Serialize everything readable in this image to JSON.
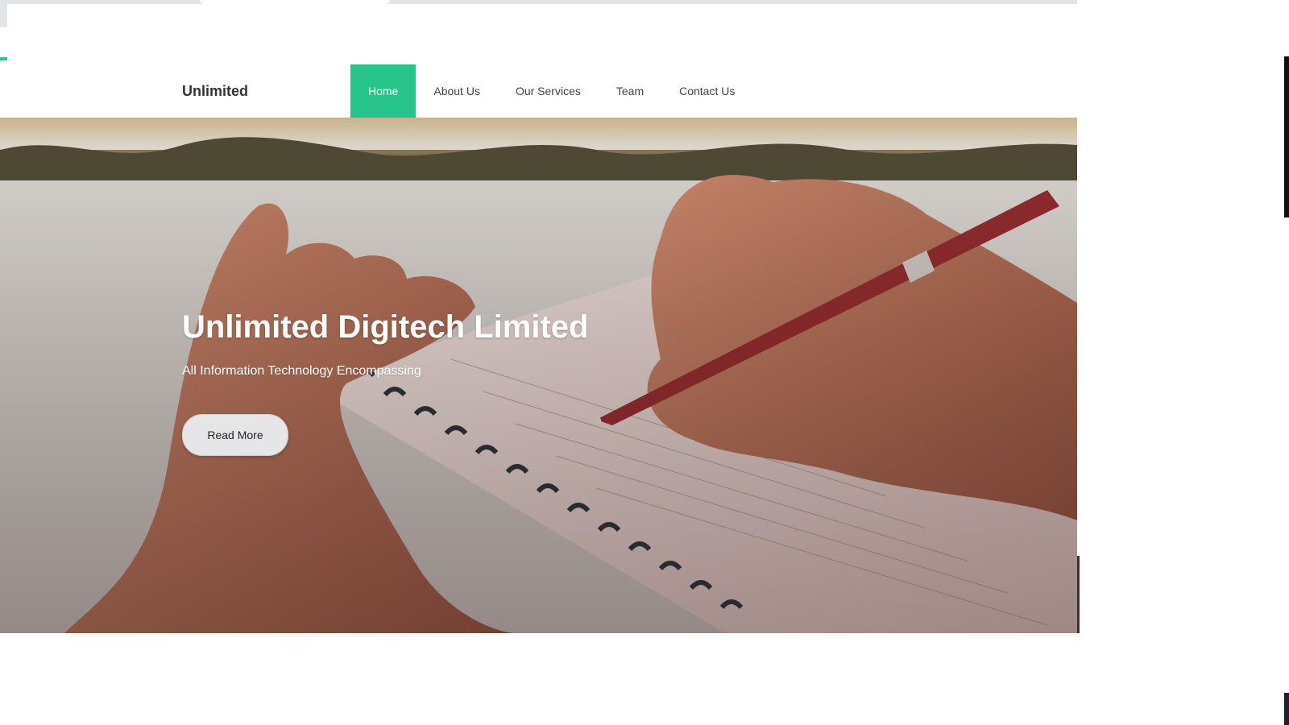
{
  "brand": {
    "name": "Unlimited"
  },
  "nav": {
    "items": [
      {
        "label": "Home",
        "active": true
      },
      {
        "label": "About Us",
        "active": false
      },
      {
        "label": "Our Services",
        "active": false
      },
      {
        "label": "Team",
        "active": false
      },
      {
        "label": "Contact Us",
        "active": false
      }
    ]
  },
  "hero": {
    "title": "Unlimited Digitech Limited",
    "subtitle": "All Information Technology Encompassing",
    "button_label": "Read More",
    "image": "hand-writing-in-notebook-with-pen"
  },
  "colors": {
    "accent": "#27c48c",
    "nav_text": "#444444",
    "brand_text": "#333333"
  }
}
